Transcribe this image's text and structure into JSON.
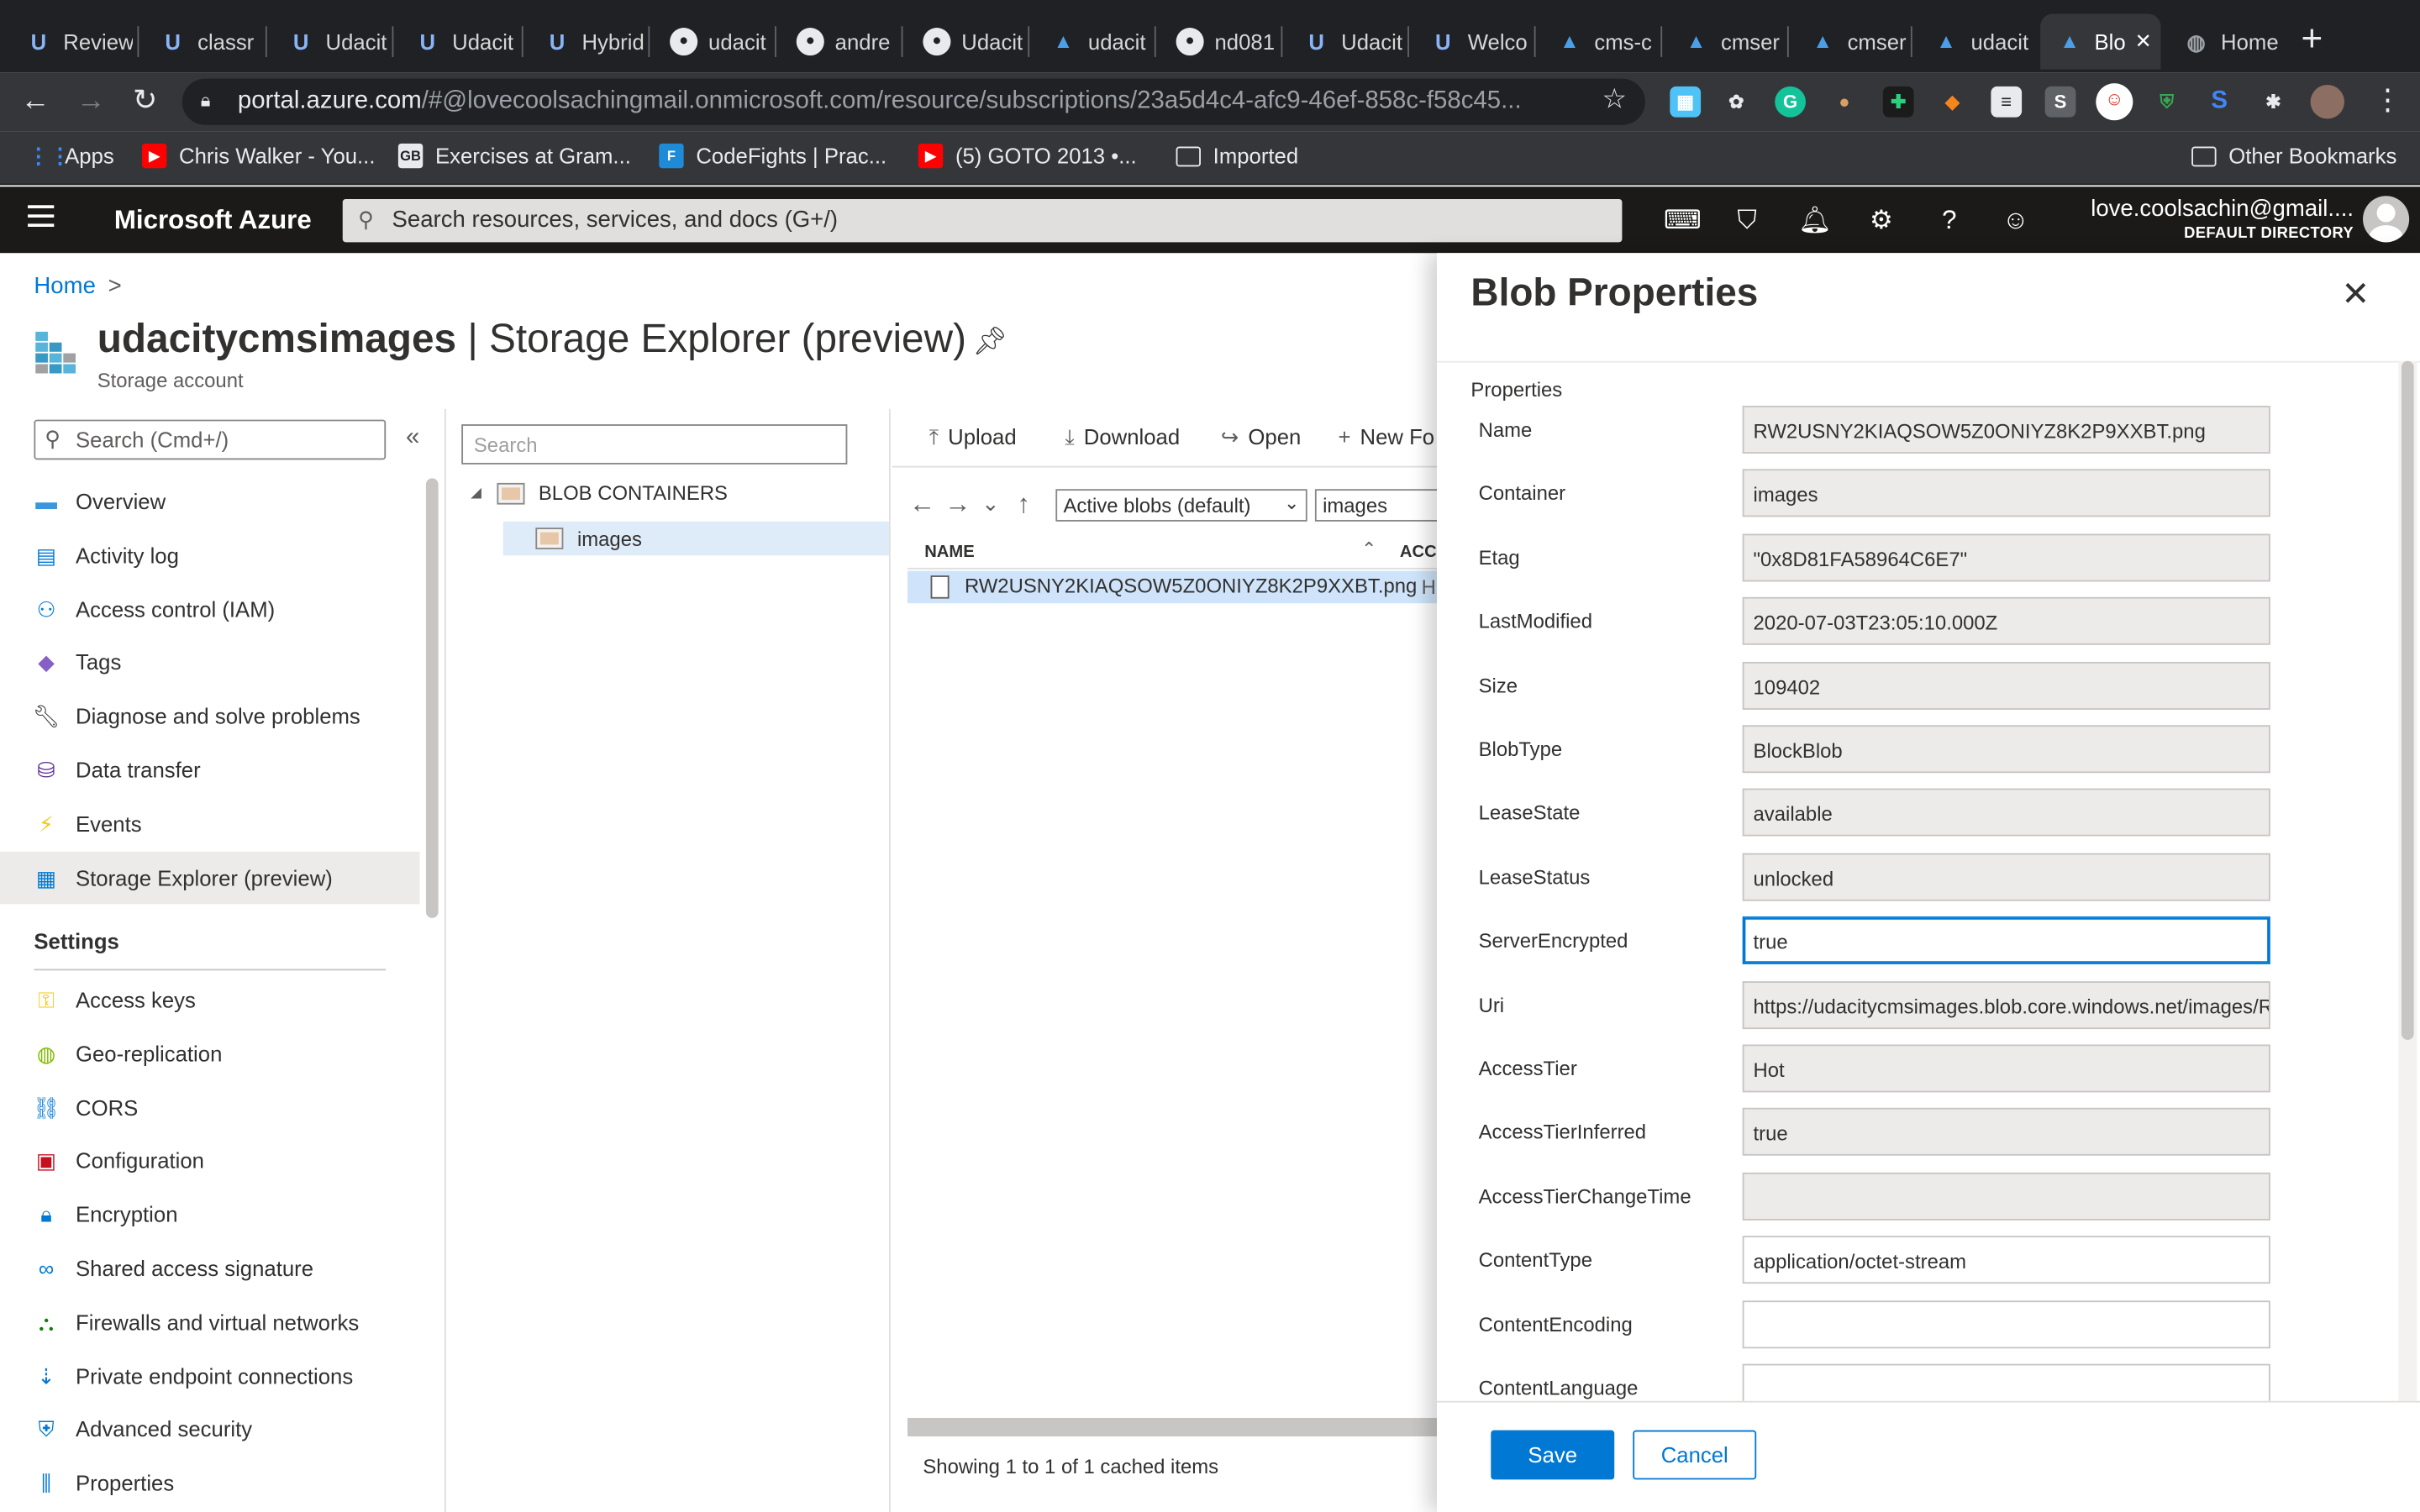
{
  "browser": {
    "tabs": [
      {
        "label": "Review",
        "icon": "udacity-icon"
      },
      {
        "label": "classr",
        "icon": "udacity-icon"
      },
      {
        "label": "Udacit",
        "icon": "udacity-icon"
      },
      {
        "label": "Udacit",
        "icon": "udacity-icon"
      },
      {
        "label": "Hybrid",
        "icon": "udacity-icon"
      },
      {
        "label": "udacit",
        "icon": "github-icon"
      },
      {
        "label": "andre",
        "icon": "github-icon"
      },
      {
        "label": "Udacit",
        "icon": "github-icon"
      },
      {
        "label": "udacit",
        "icon": "azure-icon"
      },
      {
        "label": "nd081",
        "icon": "github-icon"
      },
      {
        "label": "Udacit",
        "icon": "udacity-icon"
      },
      {
        "label": "Welco",
        "icon": "udacity-icon"
      },
      {
        "label": "cms-c",
        "icon": "azure-icon"
      },
      {
        "label": "cmser",
        "icon": "azure-icon"
      },
      {
        "label": "cmser",
        "icon": "azure-icon"
      },
      {
        "label": "udacit",
        "icon": "azure-icon"
      },
      {
        "label": "Blo",
        "icon": "azure-icon",
        "active": true
      },
      {
        "label": "Home",
        "icon": "globe-icon"
      }
    ],
    "url_host": "portal.azure.com",
    "url_rest": "/#@lovecoolsachingmail.onmicrosoft.com/resource/subscriptions/23a5d4c4-afc9-46ef-858c-f58c45...",
    "bookmarks": [
      {
        "label": "Apps",
        "icon": "apps-grid-icon",
        "color": "#4285f4"
      },
      {
        "label": "Chris Walker - You...",
        "icon": "youtube-icon",
        "color": "#ff0000"
      },
      {
        "label": "Exercises at Gram...",
        "icon": "gb-logo-icon",
        "color": "#202124"
      },
      {
        "label": "CodeFights | Prac...",
        "icon": "codefights-icon",
        "color": "#1f8bd6"
      },
      {
        "label": "(5) GOTO 2013 •...",
        "icon": "youtube-icon",
        "color": "#ff0000"
      },
      {
        "label": "Imported",
        "icon": "folder-icon",
        "color": "#9aa0a6"
      }
    ],
    "other_bookmarks": "Other Bookmarks"
  },
  "portal": {
    "brand": "Microsoft Azure",
    "search_placeholder": "Search resources, services, and docs (G+/)",
    "account_email": "love.coolsachin@gmail....",
    "account_directory": "DEFAULT DIRECTORY"
  },
  "breadcrumb": {
    "home": "Home",
    "sep": ">"
  },
  "resource": {
    "name": "udacitycmsimages",
    "page": "| Storage Explorer (preview)",
    "type": "Storage account"
  },
  "menu": {
    "search_placeholder": "Search (Cmd+/)",
    "collapse": "«",
    "items": [
      {
        "label": "Overview",
        "icon": "overview-icon",
        "color": "#3a96dd"
      },
      {
        "label": "Activity log",
        "icon": "activity-log-icon",
        "color": "#0078d4"
      },
      {
        "label": "Access control (IAM)",
        "icon": "iam-icon",
        "color": "#0078d4"
      },
      {
        "label": "Tags",
        "icon": "tag-icon",
        "color": "#8661c5"
      },
      {
        "label": "Diagnose and solve problems",
        "icon": "wrench-icon",
        "color": "#323130"
      },
      {
        "label": "Data transfer",
        "icon": "data-transfer-icon",
        "color": "#5c2d91"
      },
      {
        "label": "Events",
        "icon": "lightning-icon",
        "color": "#f2c811"
      },
      {
        "label": "Storage Explorer (preview)",
        "icon": "storage-explorer-icon",
        "color": "#0078d4",
        "selected": true
      }
    ],
    "settings_header": "Settings",
    "settings_items": [
      {
        "label": "Access keys",
        "icon": "key-icon",
        "color": "#f2c811"
      },
      {
        "label": "Geo-replication",
        "icon": "globe-icon",
        "color": "#7fba00"
      },
      {
        "label": "CORS",
        "icon": "cors-icon",
        "color": "#0078d4"
      },
      {
        "label": "Configuration",
        "icon": "briefcase-icon",
        "color": "#c50f1f"
      },
      {
        "label": "Encryption",
        "icon": "lock-icon",
        "color": "#0078d4"
      },
      {
        "label": "Shared access signature",
        "icon": "link-icon",
        "color": "#0078d4"
      },
      {
        "label": "Firewalls and virtual networks",
        "icon": "firewall-icon",
        "color": "#107c10"
      },
      {
        "label": "Private endpoint connections",
        "icon": "endpoint-icon",
        "color": "#0078d4"
      },
      {
        "label": "Advanced security",
        "icon": "shield-icon",
        "color": "#0078d4"
      },
      {
        "label": "Properties",
        "icon": "properties-icon",
        "color": "#0078d4"
      }
    ]
  },
  "tree": {
    "search_placeholder": "Search",
    "root_label": "BLOB CONTAINERS",
    "child_label": "images"
  },
  "explorer": {
    "toolbar": {
      "upload": "Upload",
      "download": "Download",
      "open": "Open",
      "new_folder": "New Fo"
    },
    "filter_selected": "Active blobs (default)",
    "path": "images",
    "col_name": "NAME",
    "col_access": "ACC",
    "file": {
      "name": "RW2USNY2KIAQSOW5Z0ONIYZ8K2P9XXBT.png",
      "access": "H"
    },
    "status": "Showing 1 to 1 of 1 cached items"
  },
  "blade": {
    "title": "Blob Properties",
    "section": "Properties",
    "properties": [
      {
        "label": "Name",
        "value": "RW2USNY2KIAQSOW5Z0ONIYZ8K2P9XXBT.png",
        "editable": false
      },
      {
        "label": "Container",
        "value": "images",
        "editable": false
      },
      {
        "label": "Etag",
        "value": "\"0x8D81FA58964C6E7\"",
        "editable": false
      },
      {
        "label": "LastModified",
        "value": "2020-07-03T23:05:10.000Z",
        "editable": false
      },
      {
        "label": "Size",
        "value": "109402",
        "editable": false
      },
      {
        "label": "BlobType",
        "value": "BlockBlob",
        "editable": false
      },
      {
        "label": "LeaseState",
        "value": "available",
        "editable": false
      },
      {
        "label": "LeaseStatus",
        "value": "unlocked",
        "editable": false
      },
      {
        "label": "ServerEncrypted",
        "value": "true",
        "editable": false,
        "focused": true
      },
      {
        "label": "Uri",
        "value": "https://udacitycmsimages.blob.core.windows.net/images/R",
        "editable": false
      },
      {
        "label": "AccessTier",
        "value": "Hot",
        "editable": false
      },
      {
        "label": "AccessTierInferred",
        "value": "true",
        "editable": false
      },
      {
        "label": "AccessTierChangeTime",
        "value": "",
        "editable": false
      },
      {
        "label": "ContentType",
        "value": "application/octet-stream",
        "editable": true
      },
      {
        "label": "ContentEncoding",
        "value": "",
        "editable": true
      },
      {
        "label": "ContentLanguage",
        "value": "",
        "editable": true
      }
    ],
    "save_label": "Save",
    "cancel_label": "Cancel"
  },
  "colors": {
    "accent": "#0078d4",
    "header_bg": "#1b1a19",
    "chrome_bg": "#202124"
  }
}
